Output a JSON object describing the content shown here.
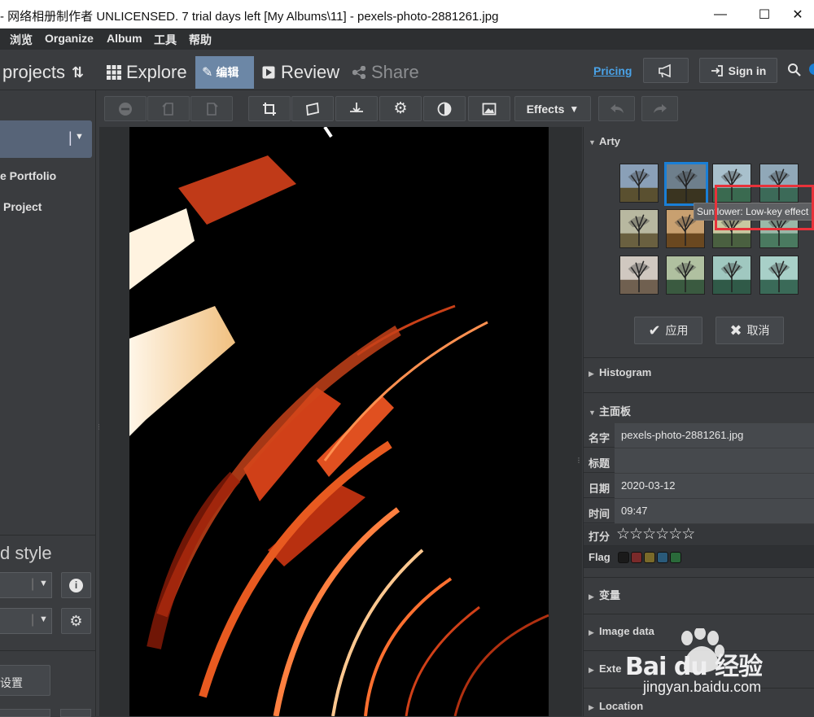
{
  "window": {
    "title": "- 网络相册制作者 UNLICENSED. 7 trial days left [My Albums\\11] - pexels-photo-2881261.jpg",
    "minimize": "—",
    "maximize": "☐",
    "close": "✕"
  },
  "menu": [
    "浏览",
    "Organize",
    "Album",
    "工具",
    "帮助"
  ],
  "nav": {
    "projects": "projects",
    "explore": "Explore",
    "edit": "编辑",
    "review": "Review",
    "share": "Share",
    "pricing": "Pricing",
    "sign_in": "Sign in"
  },
  "toolbar": {
    "effects": "Effects"
  },
  "left": {
    "item1": "e Portfolio",
    "item2": "Project",
    "style_heading": "d style",
    "settings": "设置"
  },
  "right": {
    "arty": "Arty",
    "tooltip": "Sunflower: Low-key effect",
    "apply": "应用",
    "cancel": "取消",
    "histogram": "Histogram",
    "main_panel": "主面板",
    "props": {
      "name_label": "名字",
      "name_value": "pexels-photo-2881261.jpg",
      "title_label": "标题",
      "title_value": "",
      "date_label": "日期",
      "date_value": "2020-03-12",
      "time_label": "时间",
      "time_value": "09:47",
      "rating_label": "打分",
      "rating_value": 0,
      "flag_label": "Flag"
    },
    "variables": "变量",
    "image_data": "Image data",
    "external": "Exte",
    "location": "Location"
  },
  "colors": {
    "accent_blue": "#1a7fd6",
    "pricing_link": "#4aa3e8",
    "highlight_red": "#e8323a",
    "flag_colors": [
      "#1a1a1a",
      "#7a2a2a",
      "#7a6a2a",
      "#2a5a7a",
      "#2a6a3a"
    ]
  },
  "watermark": {
    "brand": "Bai du 经验",
    "url": "jingyan.baidu.com"
  }
}
